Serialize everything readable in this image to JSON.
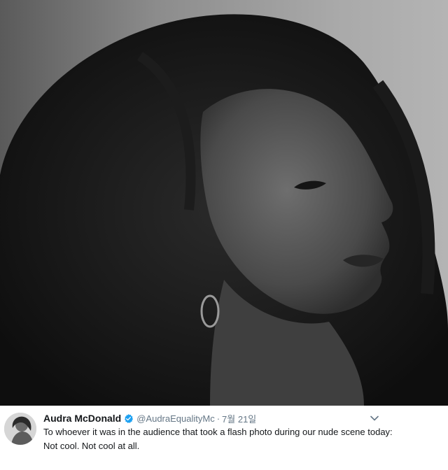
{
  "tweet": {
    "author_name": "Audra McDonald",
    "handle": "@AudraEqualityMc",
    "separator": "·",
    "date": "7월 21일",
    "text": "To whoever it was in the audience that took a flash photo during our nude scene today: Not cool. Not cool at all.",
    "verified_icon": "verified-badge-icon",
    "menu_icon": "chevron-down-icon",
    "accent_color": "#1da1f2"
  }
}
